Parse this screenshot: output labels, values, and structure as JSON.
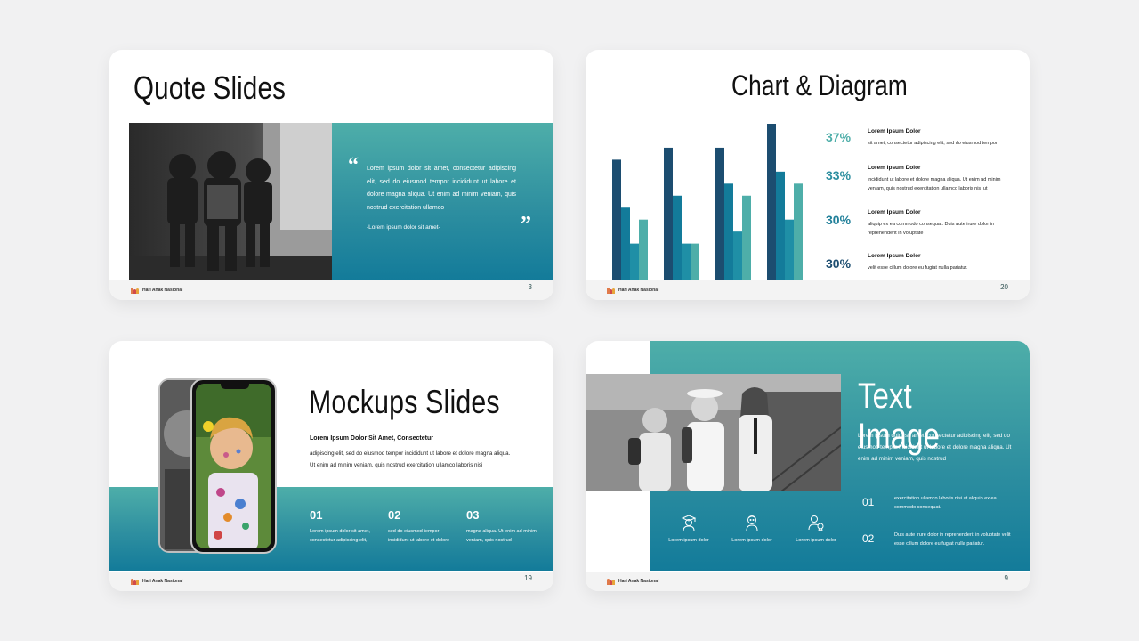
{
  "logo_text": "Hari Anak Nasional",
  "colors": {
    "teal_light": "#4eaea9",
    "teal_dark": "#137b9a",
    "navy": "#1c4d70",
    "page_bg": "#f1f1f2"
  },
  "slide1": {
    "title": "Quote Slides",
    "quote_open": "“",
    "quote_close": "”",
    "quote_text": "Lorem ipsum dolor sit amet, consectetur adipiscing elit, sed do eiusmod tempor incididunt ut labore et dolore magna aliqua. Ut enim ad minim veniam, quis nostrud exercitation ullamco",
    "attribution": "-Lorem ipsum dolor sit amet-",
    "page": "3"
  },
  "slide2": {
    "title": "Chart & Diagram",
    "page": "20",
    "stats": [
      {
        "value": "37%",
        "heading": "Lorem Ipsum Dolor",
        "text": "sit amet, consectetur adipiscing elit, sed do eiusmod tempor"
      },
      {
        "value": "33%",
        "heading": "Lorem Ipsum Dolor",
        "text": "incididunt ut labore et dolore magna aliqua. Ut enim ad minim veniam, quis nostrud exercitation ullamco laboris nisi ut"
      },
      {
        "value": "30%",
        "heading": "Lorem Ipsum Dolor",
        "text": "aliquip ex ea commodo consequat. Duis aute irure dolor in reprehenderit in voluptate"
      },
      {
        "value": "30%",
        "heading": "Lorem Ipsum Dolor",
        "text": "velit esse cillum dolore eu fugiat nulla pariatur."
      }
    ]
  },
  "chart_data": {
    "type": "bar",
    "groups": 4,
    "series_colors": [
      "#1c4d70",
      "#137b9a",
      "#1f8fa6",
      "#4eaea9"
    ],
    "values": [
      [
        100,
        60,
        30,
        50
      ],
      [
        110,
        70,
        30,
        30
      ],
      [
        110,
        80,
        40,
        70
      ],
      [
        130,
        90,
        50,
        80
      ]
    ],
    "ylim": [
      0,
      130
    ]
  },
  "slide3": {
    "title": "Mockups Slides",
    "subtitle": "Lorem Ipsum Dolor Sit Amet, Consectetur",
    "body1": "adipiscing elit, sed do eiusmod tempor incididunt ut labore et dolore magna aliqua.",
    "body2": "Ut enim ad minim veniam, quis nostrud exercitation ullamco laboris nisi",
    "page": "19",
    "steps": [
      {
        "num": "01",
        "text": "Lorem ipsum dolor sit amet, consectetur adipiscing elit,"
      },
      {
        "num": "02",
        "text": "sed do eiusmod tempor incididunt ut labore et dolore"
      },
      {
        "num": "03",
        "text": "magna aliqua. Ut enim ad minim veniam, quis nostrud"
      }
    ]
  },
  "slide4": {
    "title": "Text Image",
    "body": "Lorem ipsum dolor sit amet, consectetur adipiscing elit, sed do eiusmod tempor incididunt ut labore et dolore magna aliqua. Ut enim ad minim veniam, quis nostrud",
    "page": "9",
    "icons": [
      {
        "name": "graduate-icon",
        "label": "Lorem ipsum dolor"
      },
      {
        "name": "child-icon",
        "label": "Lorem ipsum dolor"
      },
      {
        "name": "person-award-icon",
        "label": "Lorem ipsum dolor"
      }
    ],
    "items": [
      {
        "num": "01",
        "text": "exercitation ullamco laboris nisi ut aliquip ex ea commodo consequat."
      },
      {
        "num": "02",
        "text": "Duis aute irure dolor in reprehenderit in voluptate velit esse cillum dolore eu fugiat nulla pariatur."
      }
    ]
  }
}
